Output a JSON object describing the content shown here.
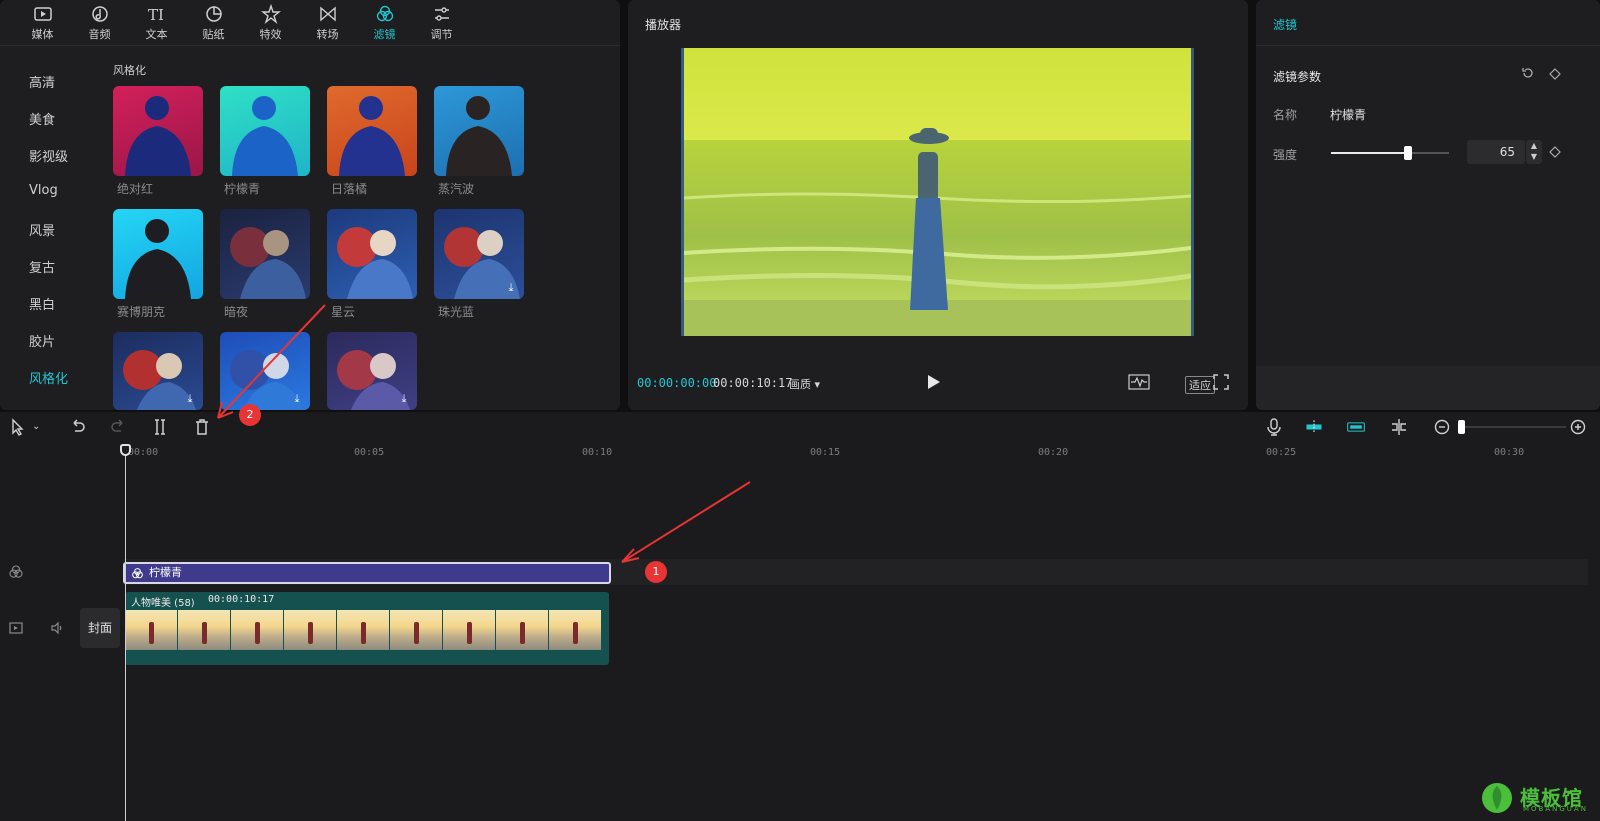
{
  "colors": {
    "accent": "#21c6d0",
    "filter_clip": "#3f3a8c",
    "video_clip": "#15514f",
    "annotation": "#e83434"
  },
  "toolbar": {
    "tabs": [
      {
        "label": "媒体",
        "icon": "media-icon"
      },
      {
        "label": "音频",
        "icon": "audio-icon"
      },
      {
        "label": "文本",
        "icon": "text-icon"
      },
      {
        "label": "贴纸",
        "icon": "sticker-icon"
      },
      {
        "label": "特效",
        "icon": "effects-icon"
      },
      {
        "label": "转场",
        "icon": "transition-icon"
      },
      {
        "label": "滤镜",
        "icon": "filter-icon",
        "active": true
      },
      {
        "label": "调节",
        "icon": "adjust-icon"
      }
    ]
  },
  "categories": [
    "高清",
    "美食",
    "影视级",
    "Vlog",
    "风景",
    "复古",
    "黑白",
    "胶片",
    "风格化"
  ],
  "active_category": "风格化",
  "filter_section_title": "风格化",
  "filters": [
    {
      "label": "绝对红"
    },
    {
      "label": "柠檬青"
    },
    {
      "label": "日落橘"
    },
    {
      "label": "蒸汽波"
    },
    {
      "label": "赛博朋克"
    },
    {
      "label": "暗夜"
    },
    {
      "label": "星云"
    },
    {
      "label": "珠光蓝"
    }
  ],
  "player": {
    "title": "播放器",
    "time_current": "00:00:00:00",
    "time_total": "00:00:10:17",
    "quality": "画质",
    "fit": "适应"
  },
  "props": {
    "title": "滤镜",
    "section": "滤镜参数",
    "name_label": "名称",
    "name_value": "柠檬青",
    "strength_label": "强度",
    "strength_value": "65",
    "strength_level": 0.65
  },
  "timeline": {
    "ticks": [
      "00:00",
      "00:05",
      "00:10",
      "00:15",
      "00:20",
      "00:25",
      "00:30"
    ],
    "filter_clip_label": "柠檬青",
    "video_clip_name": "人物唯美 (58)",
    "video_clip_duration": "00:00:10:17",
    "cover_label": "封面"
  },
  "annotations": [
    "1",
    "2"
  ],
  "watermark": {
    "text": "模板馆",
    "sub": "MOBANGUAN"
  }
}
